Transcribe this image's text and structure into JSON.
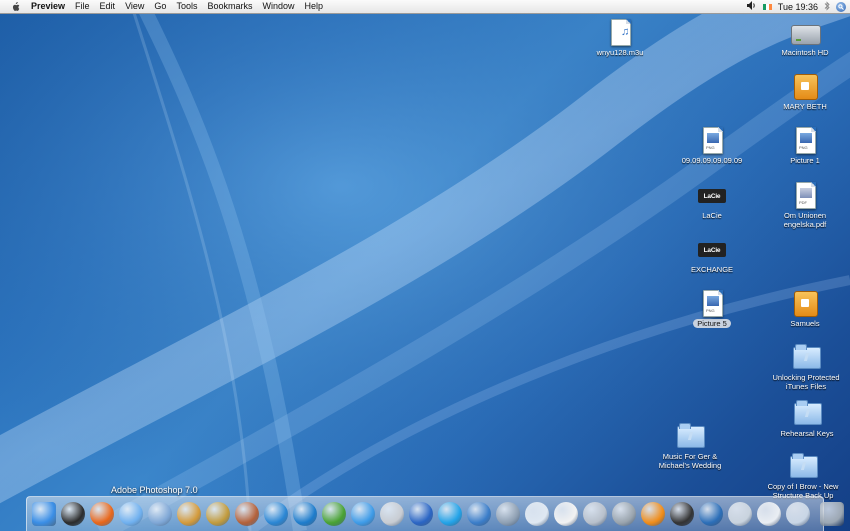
{
  "menubar": {
    "app_name": "Preview",
    "items": [
      "File",
      "Edit",
      "View",
      "Go",
      "Tools",
      "Bookmarks",
      "Window",
      "Help"
    ],
    "clock": "Tue 19:36"
  },
  "desktop_icons": [
    {
      "label": "wnyu128.m3u",
      "type": "music-doc"
    },
    {
      "label": "Macintosh HD",
      "type": "hard-disk"
    },
    {
      "label": "MARY BETH",
      "type": "home-folder"
    },
    {
      "label": "09.09.09.09.09.09",
      "type": "png-doc"
    },
    {
      "label": "Picture 1",
      "type": "png-doc"
    },
    {
      "label": "LaCie",
      "type": "lacie-disk"
    },
    {
      "label": "Om Unionen engelska.pdf",
      "type": "pdf-doc"
    },
    {
      "label": "EXCHANGE",
      "type": "lacie-disk"
    },
    {
      "label": "Picture 5",
      "type": "png-doc"
    },
    {
      "label": "Samuels",
      "type": "home-folder"
    },
    {
      "label": "Unlocking Protected iTunes Files",
      "type": "folder"
    },
    {
      "label": "Rehearsal Keys",
      "type": "folder"
    },
    {
      "label": "Music For Ger & Michael's Wedding",
      "type": "folder"
    },
    {
      "label": "Copy of I Brow - New Structure Back Up",
      "type": "folder"
    }
  ],
  "dock": {
    "tooltip": "Adobe Photoshop 7.0",
    "apps": [
      {
        "name": "finder-icon",
        "color": "#3a8ee6"
      },
      {
        "name": "dashboard-icon",
        "color": "#2b2b2b"
      },
      {
        "name": "firefox-icon",
        "color": "#e8661a"
      },
      {
        "name": "itunes-icon",
        "color": "#6fb0ef"
      },
      {
        "name": "photoshop-icon",
        "color": "#7fa7d6"
      },
      {
        "name": "iphoto-icon",
        "color": "#d49a3a"
      },
      {
        "name": "camino-icon",
        "color": "#c29b3c"
      },
      {
        "name": "app-stripes-icon",
        "color": "#b4613a"
      },
      {
        "name": "app-swirl-icon",
        "color": "#2a86d4"
      },
      {
        "name": "app-blue-u-icon",
        "color": "#1d7ccc"
      },
      {
        "name": "app-plant-icon",
        "color": "#49a233"
      },
      {
        "name": "safari-icon",
        "color": "#3d9be8"
      },
      {
        "name": "mail-icon",
        "color": "#c8ccd2"
      },
      {
        "name": "imovie-icon",
        "color": "#2a65c4"
      },
      {
        "name": "skype-icon",
        "color": "#22a3e8"
      },
      {
        "name": "iscreenshot-icon",
        "color": "#3a7dc9"
      },
      {
        "name": "app-monitor-icon",
        "color": "#8fa0b3"
      },
      {
        "name": "app-bulb-icon",
        "color": "#dfe8f2"
      },
      {
        "name": "ical-icon",
        "color": "#f2f2f2"
      },
      {
        "name": "dvd-icon",
        "color": "#b8c0cb"
      },
      {
        "name": "speaker-icon",
        "color": "#9aa4ad"
      },
      {
        "name": "vlc-icon",
        "color": "#f08c18"
      },
      {
        "name": "clapper-icon",
        "color": "#333333"
      },
      {
        "name": "app-waves-icon",
        "color": "#2b6eb8"
      },
      {
        "name": "app-rings-icon",
        "color": "#c9d3de"
      },
      {
        "name": "label-print-icon",
        "color": "#eaeef3"
      },
      {
        "name": "preview-icon",
        "color": "#c9d6e6"
      },
      {
        "name": "trash-icon",
        "color": "#9ca7b3"
      }
    ]
  }
}
